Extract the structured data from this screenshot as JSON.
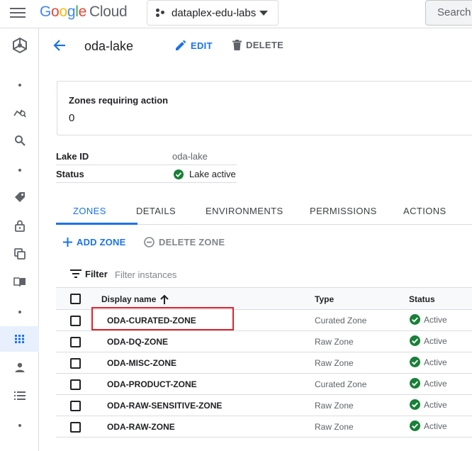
{
  "app": {
    "logo_google": "Google",
    "logo_cloud": "Cloud",
    "project": "dataplex-edu-labs",
    "search_placeholder": "Search"
  },
  "header": {
    "title": "oda-lake",
    "edit_label": "EDIT",
    "delete_label": "DELETE"
  },
  "summary_card": {
    "label": "Zones requiring action",
    "value": "0"
  },
  "info": {
    "lake_id_label": "Lake ID",
    "lake_id_value": "oda-lake",
    "status_label": "Status",
    "status_value": "Lake active"
  },
  "tabs": [
    {
      "label": "ZONES",
      "active": true
    },
    {
      "label": "DETAILS"
    },
    {
      "label": "ENVIRONMENTS"
    },
    {
      "label": "PERMISSIONS"
    },
    {
      "label": "ACTIONS"
    }
  ],
  "actions": {
    "add_zone": "ADD ZONE",
    "delete_zone": "DELETE ZONE"
  },
  "filter": {
    "label": "Filter",
    "placeholder": "Filter instances"
  },
  "table": {
    "columns": [
      "Display name",
      "Type",
      "Status"
    ],
    "rows": [
      {
        "name": "ODA-CURATED-ZONE",
        "type": "Curated Zone",
        "status": "Active"
      },
      {
        "name": "ODA-DQ-ZONE",
        "type": "Raw Zone",
        "status": "Active"
      },
      {
        "name": "ODA-MISC-ZONE",
        "type": "Raw Zone",
        "status": "Active"
      },
      {
        "name": "ODA-PRODUCT-ZONE",
        "type": "Curated Zone",
        "status": "Active"
      },
      {
        "name": "ODA-RAW-SENSITIVE-ZONE",
        "type": "Raw Zone",
        "status": "Active"
      },
      {
        "name": "ODA-RAW-ZONE",
        "type": "Raw Zone",
        "status": "Active"
      }
    ]
  },
  "colors": {
    "primary": "#1a73e8",
    "success": "#188038",
    "highlight": "#e0212e"
  },
  "rail_icons": [
    "dataplex-icon",
    "analytics-icon",
    "search-icon",
    "tag-icon",
    "lock-icon",
    "copy-icon",
    "book-icon",
    "grid-icon",
    "person-icon",
    "list-icon"
  ]
}
